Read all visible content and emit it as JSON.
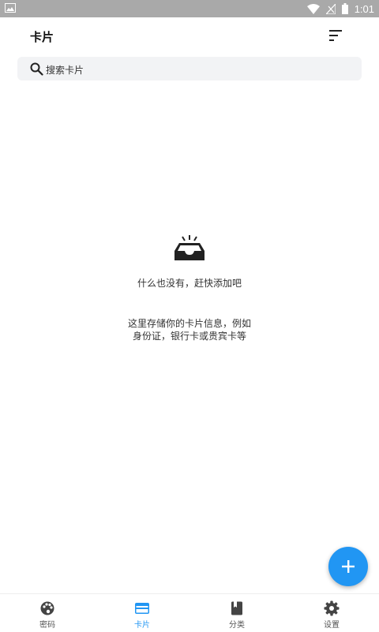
{
  "status_bar": {
    "time": "1:01"
  },
  "header": {
    "title": "卡片"
  },
  "search": {
    "placeholder": "搜索卡片"
  },
  "empty_state": {
    "title": "什么也没有，赶快添加吧",
    "description_line1": "这里存储你的卡片信息，例如",
    "description_line2": "身份证，银行卡或贵宾卡等"
  },
  "bottom_nav": [
    {
      "label": "密码",
      "icon": "palette-icon"
    },
    {
      "label": "卡片",
      "icon": "credit-card-icon",
      "active": true
    },
    {
      "label": "分类",
      "icon": "book-icon"
    },
    {
      "label": "设置",
      "icon": "gear-icon"
    }
  ],
  "colors": {
    "accent": "#2196f3",
    "status_bar": "#a9a9a9",
    "search_bg": "#f2f3f5"
  }
}
